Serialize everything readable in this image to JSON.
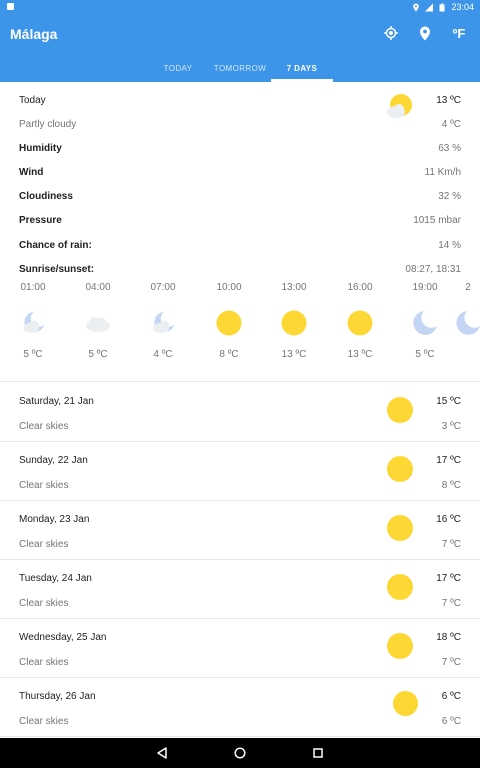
{
  "status_bar": {
    "time": "23:04"
  },
  "app": {
    "title": "Málaga",
    "unit_toggle": "ºF"
  },
  "tabs": [
    {
      "label": "TODAY",
      "active": false
    },
    {
      "label": "TOMORROW",
      "active": false
    },
    {
      "label": "7 DAYS",
      "active": true
    }
  ],
  "today": {
    "label": "Today",
    "condition": "Partly cloudy",
    "max_temp": "13 ºC",
    "min_temp": "4 ºC",
    "icon": "partly-cloudy",
    "details": [
      {
        "label": "Humidity",
        "value": "63 %"
      },
      {
        "label": "Wind",
        "value": "11 Km/h"
      },
      {
        "label": "Cloudiness",
        "value": "32 %"
      },
      {
        "label": "Pressure",
        "value": "1015 mbar"
      },
      {
        "label": "Chance of rain:",
        "value": "14 %"
      },
      {
        "label": "Sunrise/sunset:",
        "value": "08:27, 18:31"
      }
    ],
    "hourly": [
      {
        "time": "01:00",
        "icon": "night-partly-cloudy",
        "temp": "5 ºC"
      },
      {
        "time": "04:00",
        "icon": "cloudy",
        "temp": "5 ºC"
      },
      {
        "time": "07:00",
        "icon": "night-partly-cloudy",
        "temp": "4 ºC"
      },
      {
        "time": "10:00",
        "icon": "sunny",
        "temp": "8 ºC"
      },
      {
        "time": "13:00",
        "icon": "sunny",
        "temp": "13 ºC"
      },
      {
        "time": "16:00",
        "icon": "sunny",
        "temp": "13 ºC"
      },
      {
        "time": "19:00",
        "icon": "moon",
        "temp": "5 ºC"
      },
      {
        "time": "2",
        "icon": "moon",
        "temp": ""
      }
    ]
  },
  "days": [
    {
      "date": "Saturday, 21 Jan",
      "condition": "Clear skies",
      "max": "15 ºC",
      "min": "3 ºC",
      "icon": "sunny"
    },
    {
      "date": "Sunday, 22 Jan",
      "condition": "Clear skies",
      "max": "17 ºC",
      "min": "8 ºC",
      "icon": "sunny"
    },
    {
      "date": "Monday, 23 Jan",
      "condition": "Clear skies",
      "max": "16 ºC",
      "min": "7 ºC",
      "icon": "sunny"
    },
    {
      "date": "Tuesday, 24 Jan",
      "condition": "Clear skies",
      "max": "17 ºC",
      "min": "7 ºC",
      "icon": "sunny"
    },
    {
      "date": "Wednesday, 25 Jan",
      "condition": "Clear skies",
      "max": "18 ºC",
      "min": "7 ºC",
      "icon": "sunny"
    },
    {
      "date": "Thursday, 26 Jan",
      "condition": "Clear skies",
      "max": "6 ºC",
      "min": "6 ºC",
      "icon": "sunny"
    }
  ],
  "colors": {
    "primary": "#3d95ea",
    "sun": "#fdd835",
    "cloud": "#e0e0e0",
    "moon": "#c5d6f5"
  }
}
